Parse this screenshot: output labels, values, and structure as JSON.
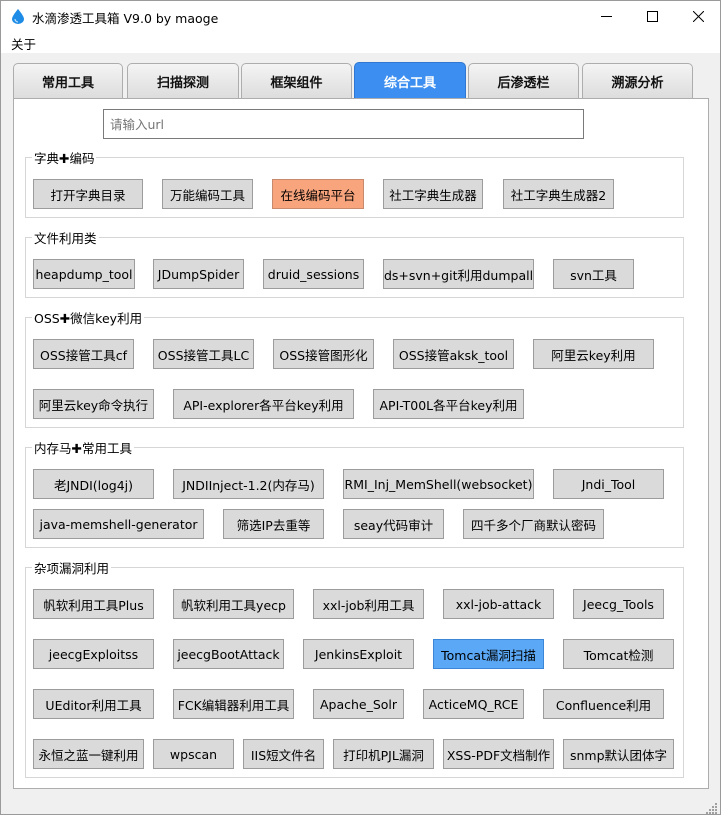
{
  "window": {
    "title": "水滴渗透工具箱 V9.0 by maoge",
    "icon": "water-drop-icon",
    "accent_color": "#1e8ce6"
  },
  "menu": {
    "items": [
      "关于"
    ]
  },
  "tabs": [
    {
      "label": "常用工具",
      "active": false
    },
    {
      "label": "扫描探测",
      "active": false
    },
    {
      "label": "框架组件",
      "active": false
    },
    {
      "label": "综合工具",
      "active": true
    },
    {
      "label": "后渗透栏",
      "active": false
    },
    {
      "label": "溯源分析",
      "active": false
    }
  ],
  "url_input": {
    "placeholder": "请输入url",
    "value": ""
  },
  "groups": [
    {
      "title": "字典✚编码",
      "buttons": [
        "打开字典目录",
        "万能编码工具",
        "在线编码平台",
        "社工字典生成器",
        "社工字典生成器2"
      ]
    },
    {
      "title": "文件利用类",
      "buttons": [
        "heapdump_tool",
        "JDumpSpider",
        "druid_sessions",
        "ds+svn+git利用dumpall",
        "svn工具"
      ]
    },
    {
      "title": "OSS✚微信key利用",
      "buttons": [
        "OSS接管工具cf",
        "OSS接管工具LC",
        "OSS接管图形化",
        "OSS接管aksk_tool",
        "阿里云key利用",
        "阿里云key命令执行",
        "API-explorer各平台key利用",
        "API-T00L各平台key利用"
      ]
    },
    {
      "title": "内存马✚常用工具",
      "buttons": [
        "老JNDI(log4j)",
        "JNDIInject-1.2(内存马)",
        "RMI_Inj_MemShell(websocket)",
        "Jndi_Tool",
        "java-memshell-generator",
        "筛选IP去重等",
        "seay代码审计",
        "四千多个厂商默认密码"
      ]
    },
    {
      "title": "杂项漏洞利用",
      "buttons": [
        "帆软利用工具Plus",
        "帆软利用工具yecp",
        "xxl-job利用工具",
        "xxl-job-attack",
        "Jeecg_Tools",
        "jeecgExploitss",
        "jeecgBootAttack",
        "JenkinsExploit",
        "Tomcat漏洞扫描",
        "Tomcat检测",
        "UEditor利用工具",
        "FCK编辑器利用工具",
        "Apache_Solr",
        "ActiceMQ_RCE",
        "Confluence利用",
        "永恒之蓝一键利用",
        "wpscan",
        "IIS短文件名",
        "打印机PJL漏洞",
        "XSS-PDF文档制作",
        "snmp默认团体字"
      ]
    }
  ],
  "colors": {
    "orange_button": "#f8a47c",
    "blue_button": "#5aa8f6",
    "active_tab": "#3c8ff0"
  }
}
